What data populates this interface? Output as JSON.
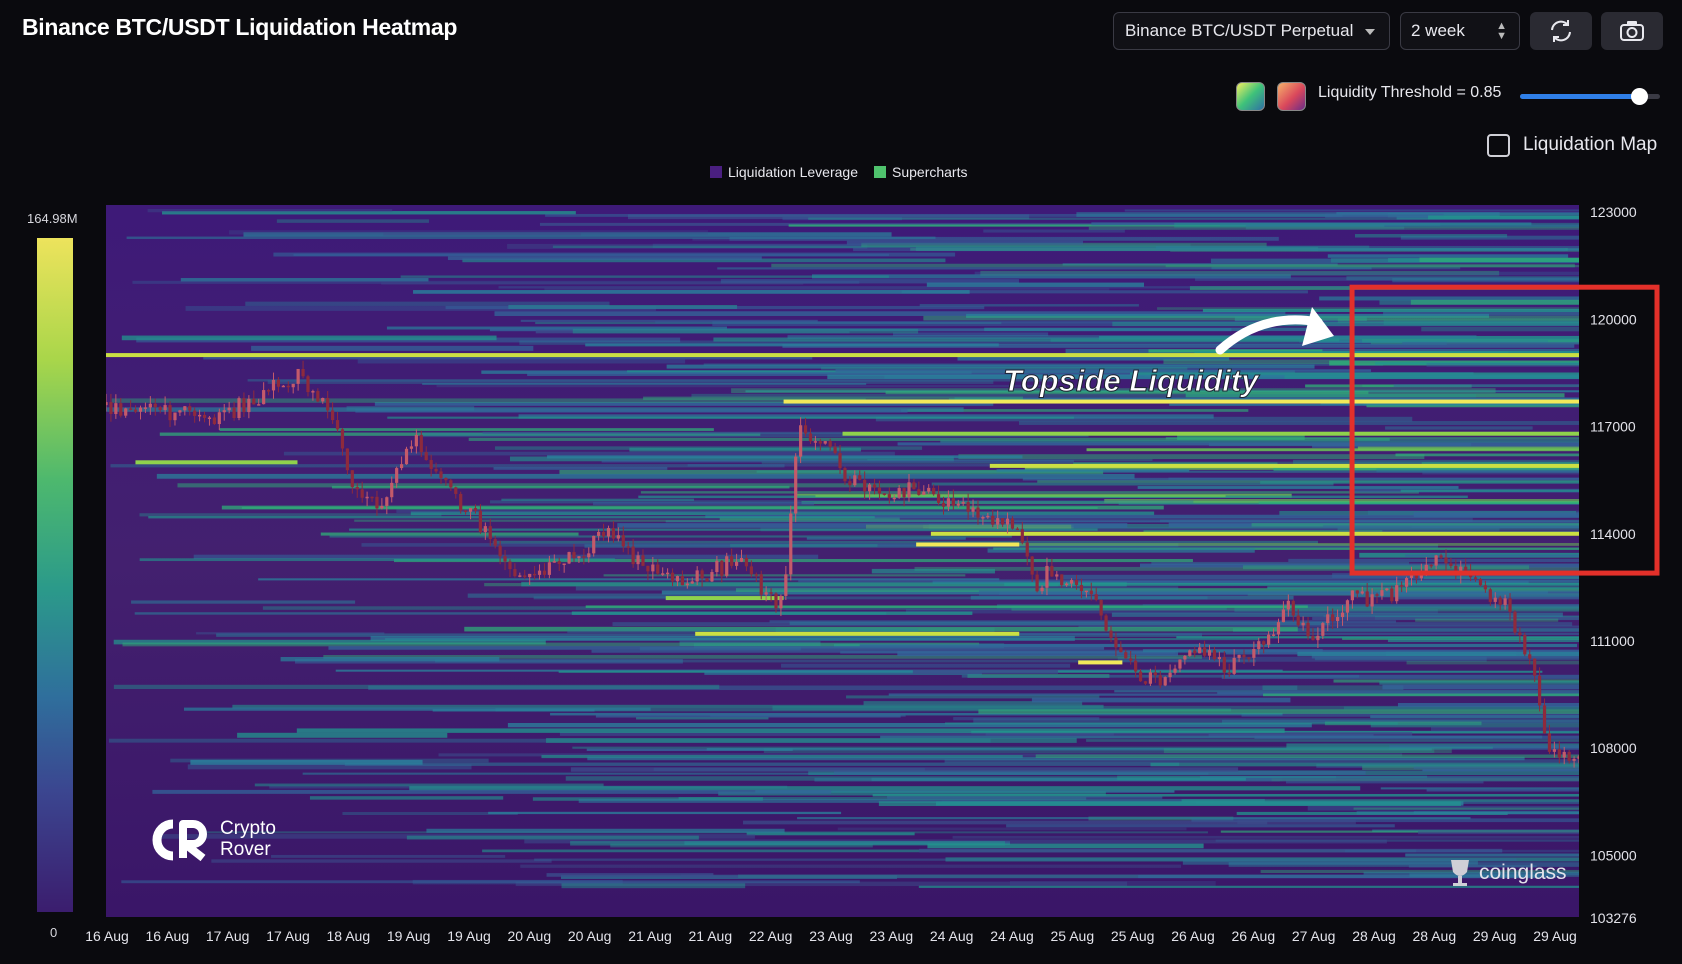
{
  "header": {
    "title": "Binance BTC/USDT Liquidation Heatmap",
    "pair_select": "Binance BTC/USDT Perpetual",
    "range_select": "2 week",
    "refresh_icon": "refresh-icon",
    "camera_icon": "camera-icon"
  },
  "controls": {
    "threshold_label": "Liquidity Threshold = 0.85",
    "threshold_value": 0.85,
    "liq_map_label": "Liquidation Map",
    "liq_map_checked": false
  },
  "legend": {
    "items": [
      {
        "label": "Liquidation Leverage",
        "color": "#4a1f80"
      },
      {
        "label": "Supercharts",
        "color": "#4fc36d"
      }
    ]
  },
  "color_scale": {
    "max_label": "164.98M",
    "min_label": "0"
  },
  "annotation": {
    "text": "Topside Liquidity"
  },
  "branding": {
    "logo_line1": "Crypto",
    "logo_line2": "Rover",
    "watermark": "coinglass"
  },
  "chart_data": {
    "type": "heatmap",
    "title": "Binance BTC/USDT Liquidation Heatmap",
    "x_tick_labels": [
      "16 Aug",
      "16 Aug",
      "17 Aug",
      "17 Aug",
      "18 Aug",
      "19 Aug",
      "19 Aug",
      "20 Aug",
      "20 Aug",
      "21 Aug",
      "21 Aug",
      "22 Aug",
      "23 Aug",
      "23 Aug",
      "24 Aug",
      "24 Aug",
      "25 Aug",
      "25 Aug",
      "26 Aug",
      "26 Aug",
      "27 Aug",
      "28 Aug",
      "28 Aug",
      "29 Aug",
      "29 Aug"
    ],
    "y_ticks": [
      123000,
      120000,
      117000,
      114000,
      111000,
      108000,
      105000
    ],
    "y_min_label": "103276",
    "ylim": [
      103276,
      123200
    ],
    "colorbar_range_usd": [
      0,
      164980000
    ],
    "price_path": {
      "t": [
        0,
        0.04,
        0.08,
        0.1,
        0.13,
        0.14,
        0.15,
        0.17,
        0.19,
        0.2,
        0.21,
        0.23,
        0.25,
        0.27,
        0.29,
        0.32,
        0.33,
        0.34,
        0.36,
        0.38,
        0.4,
        0.43,
        0.45,
        0.46,
        0.47,
        0.49,
        0.5,
        0.53,
        0.55,
        0.58,
        0.62,
        0.63,
        0.64,
        0.67,
        0.69,
        0.7,
        0.72,
        0.74,
        0.76,
        0.79,
        0.8,
        0.82,
        0.83,
        0.85,
        0.86,
        0.88,
        0.9,
        0.92,
        0.93,
        0.95,
        0.96,
        0.97,
        0.98,
        1.0
      ],
      "price": [
        117600,
        117400,
        117300,
        117800,
        118400,
        118000,
        117600,
        115200,
        114800,
        115900,
        116600,
        115300,
        114500,
        113100,
        112800,
        113500,
        113700,
        114200,
        113300,
        112700,
        112700,
        113300,
        112200,
        112000,
        116900,
        116400,
        115700,
        115000,
        115300,
        114700,
        114200,
        112500,
        112900,
        112300,
        110500,
        110100,
        109800,
        110900,
        110200,
        111200,
        112000,
        111100,
        111600,
        112400,
        112100,
        112500,
        113300,
        113000,
        112600,
        112000,
        111200,
        109800,
        107800,
        107600
      ]
    },
    "liquidity_bands": [
      {
        "price": 119000,
        "from": 0.0,
        "to": 1.0,
        "intensity": 0.85
      },
      {
        "price": 117700,
        "from": 0.46,
        "to": 1.0,
        "intensity": 1.0
      },
      {
        "price": 116800,
        "from": 0.5,
        "to": 1.0,
        "intensity": 0.8
      },
      {
        "price": 115900,
        "from": 0.6,
        "to": 1.0,
        "intensity": 0.9
      },
      {
        "price": 114000,
        "from": 0.56,
        "to": 1.0,
        "intensity": 0.85
      },
      {
        "price": 113700,
        "from": 0.55,
        "to": 0.62,
        "intensity": 1.0
      },
      {
        "price": 112200,
        "from": 0.38,
        "to": 0.46,
        "intensity": 0.7
      },
      {
        "price": 111200,
        "from": 0.4,
        "to": 0.62,
        "intensity": 0.9
      },
      {
        "price": 110400,
        "from": 0.66,
        "to": 0.69,
        "intensity": 1.0
      },
      {
        "price": 116000,
        "from": 0.02,
        "to": 0.13,
        "intensity": 0.6
      }
    ],
    "highlight_box": {
      "price_top": 120900,
      "price_bottom": 112900,
      "t_start": 0.85,
      "t_end": 1.0,
      "color": "#e3302a"
    }
  }
}
